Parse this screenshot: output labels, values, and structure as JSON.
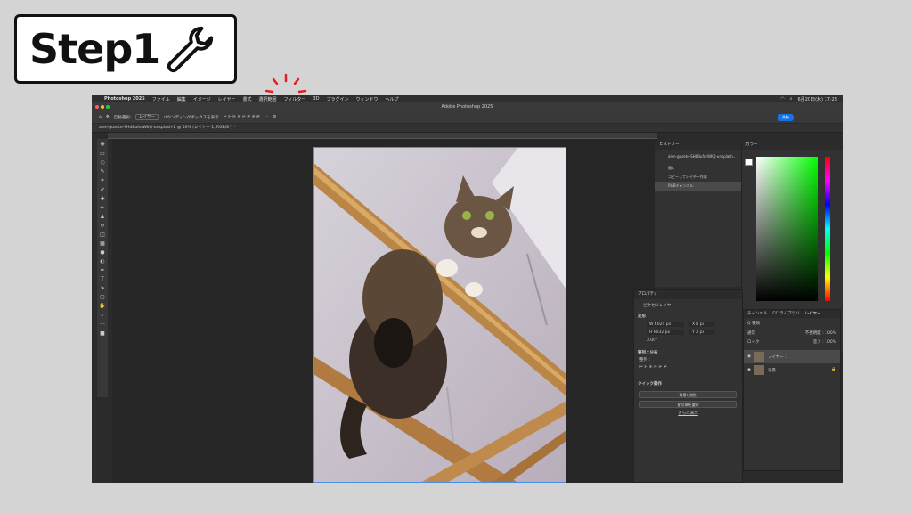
{
  "badge": {
    "title": "Step1"
  },
  "menubar": {
    "app_name": "Photoshop 2025",
    "items": [
      "ファイル",
      "編集",
      "イメージ",
      "レイヤー",
      "書式",
      "選択範囲",
      "フィルター",
      "3D",
      "プラグイン",
      "ウィンドウ",
      "ヘルプ"
    ],
    "datetime": "6月20日(木) 17:23"
  },
  "titlebar": {
    "title": "Adobe Photoshop 2025"
  },
  "options": {
    "auto_select": "自動選択:",
    "layer": "レイヤー",
    "bbox": "バウンディングボックスを表示",
    "share": "共有"
  },
  "document_tab": {
    "title": "alen-gusete-SHdBuforWkQ-unsplash-2 @ 50% (レイヤー 1, RGB/8*) *"
  },
  "history": {
    "panel_title": "ヒストリー",
    "snapshot": "alen-gusete-SHdBuforWkQ-unsplash...",
    "items": [
      "開く",
      "コピーしてレイヤー作成",
      "RGBチャンネル"
    ]
  },
  "color_panel": {
    "title": "カラー"
  },
  "properties": {
    "title": "プロパティ",
    "kind": "ピクセルレイヤー",
    "transform_label": "変形",
    "w": "W 4024 px",
    "x": "X 0 px",
    "h": "H 6032 px",
    "y": "Y 0 px",
    "angle": "0.00°",
    "align_label": "整列と分布",
    "align_sub": "整列 :",
    "quick_label": "クイック操作",
    "btn_remove_bg": "背景を削除",
    "btn_select_subject": "被写体を選択",
    "more": "さらに表示"
  },
  "layers": {
    "tabs": [
      "チャンネル",
      "CC ライブラリ",
      "レイヤー"
    ],
    "filter": "Q 種類",
    "blend": "通常",
    "opacity_label": "不透明度 : 100%",
    "lock_label": "ロック :",
    "fill_label": "塗り : 100%",
    "items": [
      "レイヤー 1",
      "背景"
    ]
  },
  "colors": {
    "accent": "#1473e6",
    "burst": "#e02020"
  }
}
